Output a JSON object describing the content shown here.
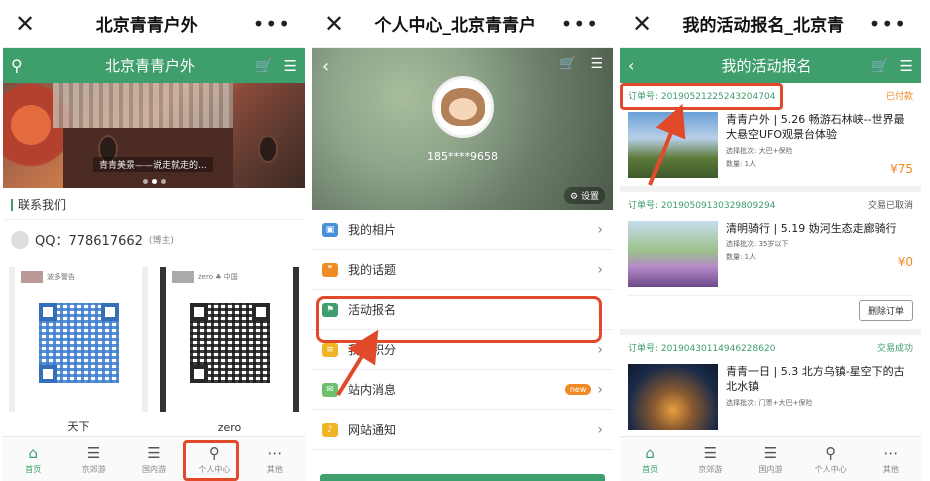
{
  "panel1": {
    "wx_title": "北京青青户外",
    "header_title": "北京青青户外",
    "banner_caption": "青青美景——说走就走的...",
    "section_title": "联系我们",
    "qq_text": "QQ：778617662",
    "qq_sub": "(博主)",
    "cards": [
      {
        "top": "波多警告",
        "name": "天下"
      },
      {
        "top": "zero ♣ 中国",
        "name": "zero"
      }
    ],
    "tabs": [
      {
        "icon": "⌂",
        "label": "首页"
      },
      {
        "icon": "☰",
        "label": "京郊游"
      },
      {
        "icon": "☰",
        "label": "国内游"
      },
      {
        "icon": "⚲",
        "label": "个人中心"
      },
      {
        "icon": "⋯",
        "label": "其他"
      }
    ]
  },
  "panel2": {
    "wx_title": "个人中心_北京青青户",
    "phone": "185****9658",
    "settings": "设置",
    "menu": [
      {
        "label": "我的相片",
        "color": "#4a90d9"
      },
      {
        "label": "我的话题",
        "color": "#f08a24"
      },
      {
        "label": "活动报名",
        "color": "#3e9e6c"
      },
      {
        "label": "我的积分",
        "color": "#f0b424"
      },
      {
        "label": "站内消息",
        "color": "#6cc06c",
        "badge": "new"
      },
      {
        "label": "网站通知",
        "color": "#f0b424"
      }
    ]
  },
  "panel3": {
    "wx_title": "我的活动报名_北京青",
    "header_title": "我的活动报名",
    "orders": [
      {
        "no": "订单号: 20190521225243204704",
        "status": "已付款",
        "title": "青青户外 | 5.26 畅游石林峡--世界最大悬空UFO观景台体验",
        "batch": "选择批次: 大巴+保险",
        "qty": "数量: 1人",
        "price": "¥75"
      },
      {
        "no": "订单号: 20190509130329809294",
        "status": "交易已取消",
        "title": "清明骑行 | 5.19 妫河生态走廊骑行",
        "batch": "选择批次: 35岁以下",
        "qty": "数量: 1人",
        "price": "¥0",
        "action": "删除订单"
      },
      {
        "no": "订单号: 20190430114946228620",
        "status": "交易成功",
        "title": "青青一日 | 5.3 北方乌镇-星空下的古北水镇",
        "batch": "选择批次: 门票+大巴+保险"
      }
    ],
    "tabs": [
      {
        "icon": "⌂",
        "label": "首页"
      },
      {
        "icon": "☰",
        "label": "京郊游"
      },
      {
        "icon": "☰",
        "label": "国内游"
      },
      {
        "icon": "⚲",
        "label": "个人中心"
      },
      {
        "icon": "⋯",
        "label": "其他"
      }
    ]
  },
  "common": {
    "close": "✕",
    "more": "•••",
    "back": "‹",
    "cart": "🛒",
    "list": "☰",
    "user": "⚲",
    "chev": "›"
  }
}
